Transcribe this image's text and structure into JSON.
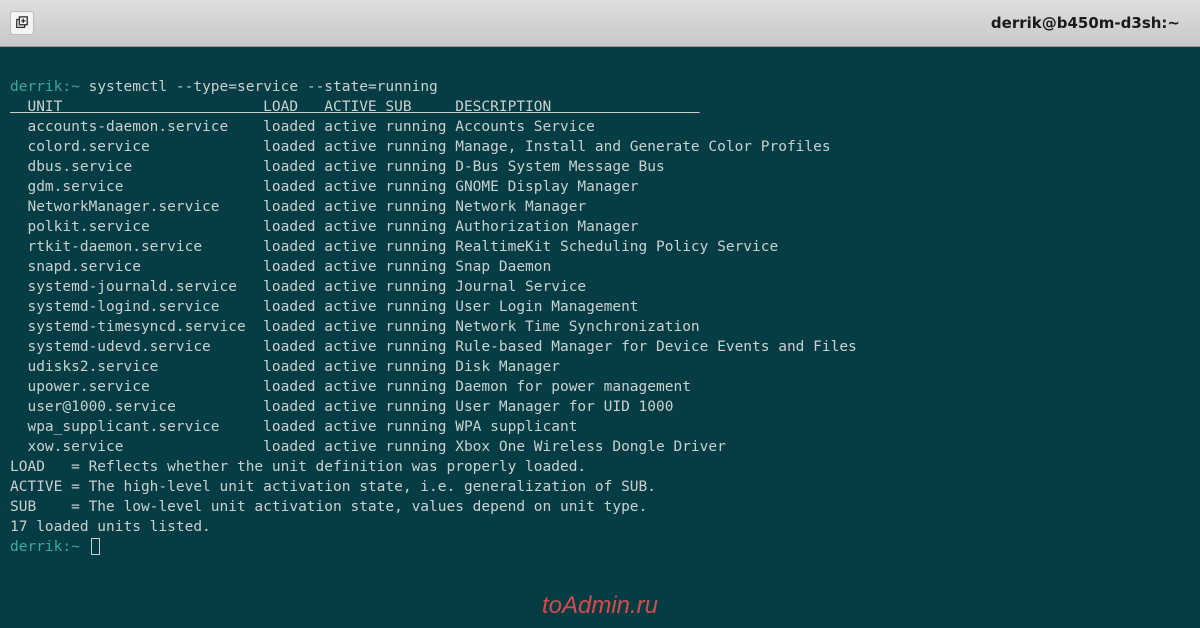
{
  "titlebar": {
    "title": "derrik@b450m-d3sh:~"
  },
  "prompt": {
    "user": "derrik",
    "sep": ":",
    "path": "~",
    "marker": " "
  },
  "command": "systemctl --type=service --state=running",
  "headers": {
    "unit": "UNIT",
    "load": "LOAD",
    "active": "ACTIVE",
    "sub": "SUB",
    "description": "DESCRIPTION"
  },
  "services": [
    {
      "unit": "accounts-daemon.service",
      "load": "loaded",
      "active": "active",
      "sub": "running",
      "desc": "Accounts Service"
    },
    {
      "unit": "colord.service",
      "load": "loaded",
      "active": "active",
      "sub": "running",
      "desc": "Manage, Install and Generate Color Profiles"
    },
    {
      "unit": "dbus.service",
      "load": "loaded",
      "active": "active",
      "sub": "running",
      "desc": "D-Bus System Message Bus"
    },
    {
      "unit": "gdm.service",
      "load": "loaded",
      "active": "active",
      "sub": "running",
      "desc": "GNOME Display Manager"
    },
    {
      "unit": "NetworkManager.service",
      "load": "loaded",
      "active": "active",
      "sub": "running",
      "desc": "Network Manager"
    },
    {
      "unit": "polkit.service",
      "load": "loaded",
      "active": "active",
      "sub": "running",
      "desc": "Authorization Manager"
    },
    {
      "unit": "rtkit-daemon.service",
      "load": "loaded",
      "active": "active",
      "sub": "running",
      "desc": "RealtimeKit Scheduling Policy Service"
    },
    {
      "unit": "snapd.service",
      "load": "loaded",
      "active": "active",
      "sub": "running",
      "desc": "Snap Daemon"
    },
    {
      "unit": "systemd-journald.service",
      "load": "loaded",
      "active": "active",
      "sub": "running",
      "desc": "Journal Service"
    },
    {
      "unit": "systemd-logind.service",
      "load": "loaded",
      "active": "active",
      "sub": "running",
      "desc": "User Login Management"
    },
    {
      "unit": "systemd-timesyncd.service",
      "load": "loaded",
      "active": "active",
      "sub": "running",
      "desc": "Network Time Synchronization"
    },
    {
      "unit": "systemd-udevd.service",
      "load": "loaded",
      "active": "active",
      "sub": "running",
      "desc": "Rule-based Manager for Device Events and Files"
    },
    {
      "unit": "udisks2.service",
      "load": "loaded",
      "active": "active",
      "sub": "running",
      "desc": "Disk Manager"
    },
    {
      "unit": "upower.service",
      "load": "loaded",
      "active": "active",
      "sub": "running",
      "desc": "Daemon for power management"
    },
    {
      "unit": "user@1000.service",
      "load": "loaded",
      "active": "active",
      "sub": "running",
      "desc": "User Manager for UID 1000"
    },
    {
      "unit": "wpa_supplicant.service",
      "load": "loaded",
      "active": "active",
      "sub": "running",
      "desc": "WPA supplicant"
    },
    {
      "unit": "xow.service",
      "load": "loaded",
      "active": "active",
      "sub": "running",
      "desc": "Xbox One Wireless Dongle Driver"
    }
  ],
  "legend": {
    "load": "LOAD   = Reflects whether the unit definition was properly loaded.",
    "active": "ACTIVE = The high-level unit activation state, i.e. generalization of SUB.",
    "sub": "SUB    = The low-level unit activation state, values depend on unit type.",
    "count": "17 loaded units listed."
  },
  "watermark": "toAdmin.ru",
  "col_widths": {
    "unit": 27,
    "load": 7,
    "active": 7,
    "sub": 8
  }
}
